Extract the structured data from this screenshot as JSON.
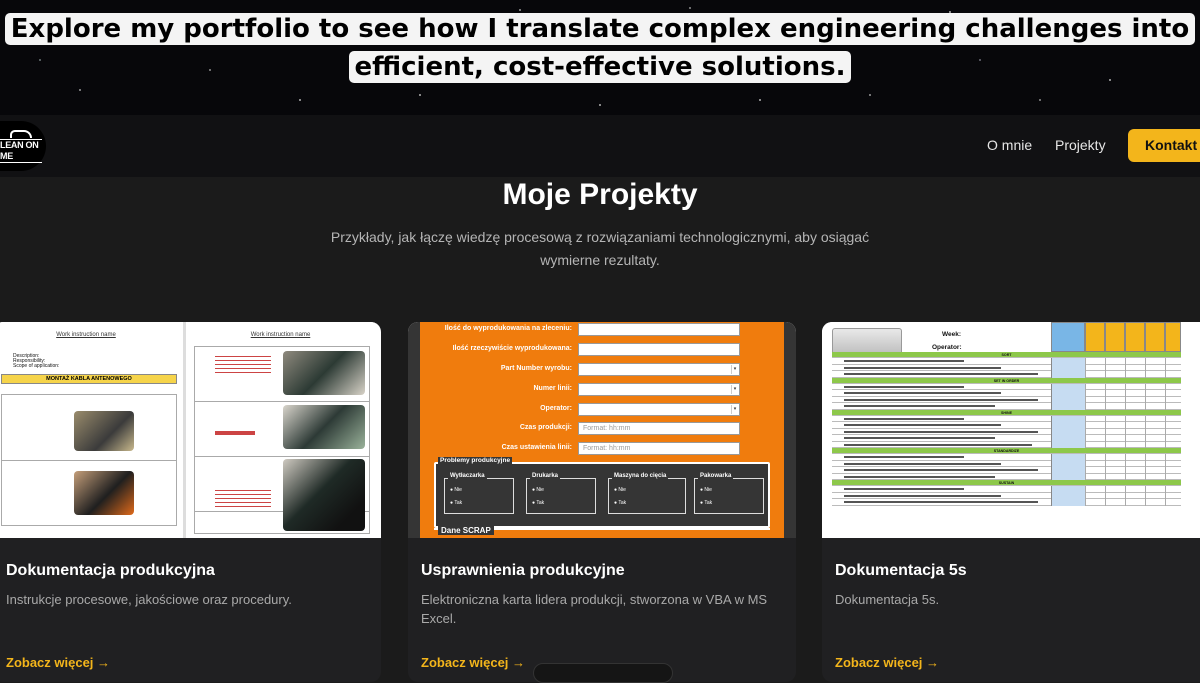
{
  "caption": {
    "line1": "Explore my portfolio to see how I translate complex engineering challenges into",
    "line2": "efficient, cost-effective solutions."
  },
  "navbar": {
    "logo_text": "LEAN ON ME",
    "links": [
      "O mnie",
      "Projekty"
    ],
    "cta": "Kontakt"
  },
  "section": {
    "title": "Moje Projekty",
    "subtitle": "Przykłady, jak łączę wiedzę procesową z rozwiązaniami technologicznymi, aby osiągać wymierne rezultaty."
  },
  "cards": [
    {
      "title": "Dokumentacja produkcyjna",
      "description": "Instrukcje procesowe, jakościowe oraz procedury.",
      "link": "Zobacz więcej →",
      "thumb": {
        "doc_header": "Work instruction name",
        "meta": [
          "Description:",
          "Responsibility:",
          "Scope of application:"
        ],
        "yellow_bar": "MONTAŻ KABLA ANTENOWEGO"
      }
    },
    {
      "title": "Usprawnienia produkcyjne",
      "description": "Elektroniczna karta lidera produkcji, stworzona w VBA w MS Excel.",
      "link": "Zobacz więcej →",
      "thumb": {
        "fields": [
          {
            "label": "Ilość do wyprodukowania na zleceniu:",
            "value": "",
            "dropdown": false
          },
          {
            "label": "Ilość rzeczywiście wyprodukowana:",
            "value": "",
            "dropdown": false
          },
          {
            "label": "Part Number wyrobu:",
            "value": "",
            "dropdown": true
          },
          {
            "label": "Numer linii:",
            "value": "",
            "dropdown": true
          },
          {
            "label": "Operator:",
            "value": "",
            "dropdown": true
          },
          {
            "label": "Czas produkcji:",
            "value": "Format: hh:mm",
            "dropdown": false
          },
          {
            "label": "Czas ustawienia linii:",
            "value": "Format: hh:mm",
            "dropdown": false
          }
        ],
        "panel_label": "Problemy produkcyjne",
        "groups": [
          "Wytłaczarka",
          "Drukarka",
          "Maszyna do cięcia",
          "Pakowarka"
        ],
        "options": [
          "Nie",
          "Tak"
        ],
        "scrap_label": "Dane SCRAP"
      }
    },
    {
      "title": "Dokumentacja 5s",
      "description": "Dokumentacja 5s.",
      "link": "Zobacz więcej →",
      "thumb": {
        "week_label": "Week:",
        "operator_label": "Operator:",
        "sections": [
          "SORT",
          "SET IN ORDER",
          "SHINE",
          "STANDARDIZE",
          "SUSTAIN"
        ]
      }
    }
  ],
  "colors": {
    "accent": "#f3b51b",
    "background": "#1b1b1b",
    "navbar": "#111113",
    "card": "#202022",
    "form_orange": "#f07c0d"
  }
}
